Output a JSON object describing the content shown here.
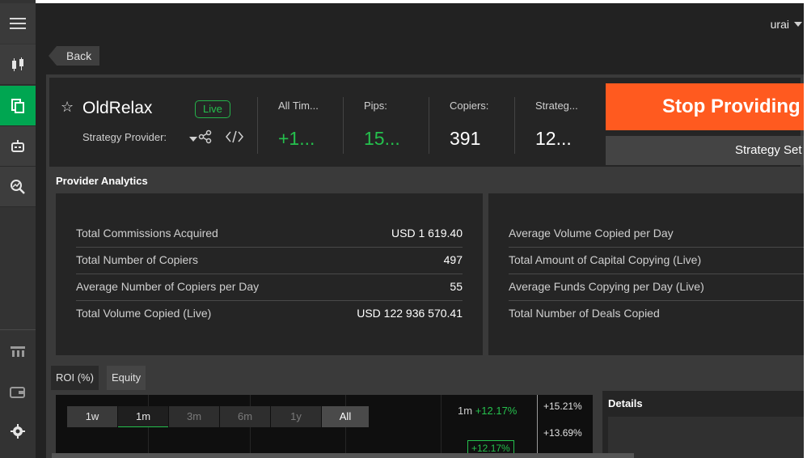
{
  "user": {
    "name": "urai"
  },
  "nav": {
    "back_label": "Back"
  },
  "provider": {
    "name": "OldRelax",
    "status": "Live",
    "role_label": "Strategy Provider:"
  },
  "stats": [
    {
      "label": "All Tim...",
      "value": "+1...",
      "tone": "green"
    },
    {
      "label": "Pips:",
      "value": "15...",
      "tone": "green"
    },
    {
      "label": "Copiers:",
      "value": "391",
      "tone": "white"
    },
    {
      "label": "Strateg...",
      "value": "12...",
      "tone": "white"
    }
  ],
  "actions": {
    "stop_label": "Stop Providing",
    "settings_label": "Strategy Set"
  },
  "analytics": {
    "title": "Provider Analytics",
    "left": [
      {
        "label": "Total Commissions Acquired",
        "value": "USD 1 619.40"
      },
      {
        "label": "Total Number of Copiers",
        "value": "497"
      },
      {
        "label": "Average Number of Copiers per Day",
        "value": "55"
      },
      {
        "label": "Total Volume Copied (Live)",
        "value": "USD 122 936 570.41"
      }
    ],
    "right": [
      {
        "label": "Average Volume Copied per Day",
        "value": ""
      },
      {
        "label": "Total Amount of Capital Copying (Live)",
        "value": ""
      },
      {
        "label": "Average Funds Copying per Day (Live)",
        "value": ""
      },
      {
        "label": "Total Number of Deals Copied",
        "value": ""
      }
    ]
  },
  "tabs": [
    {
      "label": "ROI (%)",
      "active": true
    },
    {
      "label": "Equity",
      "active": false
    }
  ],
  "chart": {
    "ranges": [
      {
        "label": "1w",
        "state": "on"
      },
      {
        "label": "1m",
        "state": "selected"
      },
      {
        "label": "3m",
        "state": "off"
      },
      {
        "label": "6m",
        "state": "off"
      },
      {
        "label": "1y",
        "state": "off"
      },
      {
        "label": "All",
        "state": "all"
      }
    ],
    "legend_period": "1m",
    "legend_value": "+12.17%",
    "y_ticks": [
      "+15.21%",
      "+13.69%"
    ],
    "marker_value": "+12.17%"
  },
  "details": {
    "title": "Details"
  },
  "colors": {
    "accent_green": "#25c04d",
    "stop_orange": "#ff5a1f",
    "active_rail": "#00a651"
  }
}
